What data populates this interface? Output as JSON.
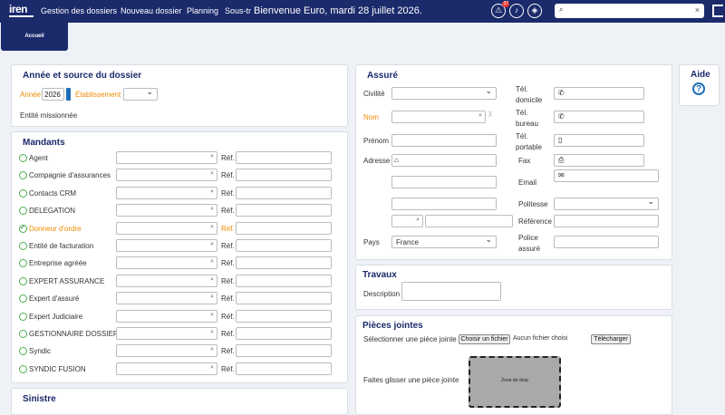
{
  "topbar": {
    "logo": "iren",
    "nav": [
      "Gestion des dossiers",
      "Nouveau dossier",
      "Planning",
      "Sous-tr"
    ],
    "welcome": "Bienvenue Euro, mardi 28 juillet 2026.",
    "notif_count": "37",
    "search_placeholder": ""
  },
  "tabs": {
    "home": "Accueil"
  },
  "annee": {
    "title": "Année et source du dossier",
    "year_label": "Année",
    "year_value": "2026",
    "etab_label": "Établissement",
    "entite": "Entité missionnée"
  },
  "mandants": {
    "title": "Mandants",
    "ref_label": "Réf.",
    "rows": [
      {
        "label": "Agent",
        "highlight": false
      },
      {
        "label": "Compagnie d'assurances",
        "highlight": false
      },
      {
        "label": "Contacts CRM",
        "highlight": false
      },
      {
        "label": "DELEGATION",
        "highlight": false
      },
      {
        "label": "Donneur d'ordre",
        "highlight": true
      },
      {
        "label": "Entité de facturation",
        "highlight": false
      },
      {
        "label": "Entreprise agréée",
        "highlight": false
      },
      {
        "label": "EXPERT ASSURANCE",
        "highlight": false
      },
      {
        "label": "Expert d'assuré",
        "highlight": false
      },
      {
        "label": "Expert Judiciaire",
        "highlight": false
      },
      {
        "label": "GESTIONNAIRE DOSSIER",
        "highlight": false
      },
      {
        "label": "Syndic",
        "highlight": false
      },
      {
        "label": "SYNDIC FUSION",
        "highlight": false
      }
    ]
  },
  "sinistre": {
    "title": "Sinistre"
  },
  "assure": {
    "title": "Assuré",
    "civilite": "Civilité",
    "nom": "Nom",
    "prenom": "Prénom",
    "adresse": "Adresse",
    "pays": "Pays",
    "pays_value": "France",
    "tel_dom": "Tél. domicile",
    "tel_bur": "Tél. bureau",
    "tel_port": "Tél. portable",
    "fax": "Fax",
    "email": "Email",
    "politesse": "Politesse",
    "reference": "Référence",
    "police": "Police assuré"
  },
  "travaux": {
    "title": "Travaux",
    "description": "Description"
  },
  "pieces": {
    "title": "Pièces jointes",
    "select_label": "Sélectionner une pièce jointe",
    "choose_btn": "Choisir un fichier",
    "no_file": "Aucun fichier choisi",
    "upload_btn": "Télécharger",
    "drag_label": "Faites glisser une pièce jointe",
    "drop_zone": "Zone de drop"
  },
  "aide": {
    "title": "Aide"
  }
}
